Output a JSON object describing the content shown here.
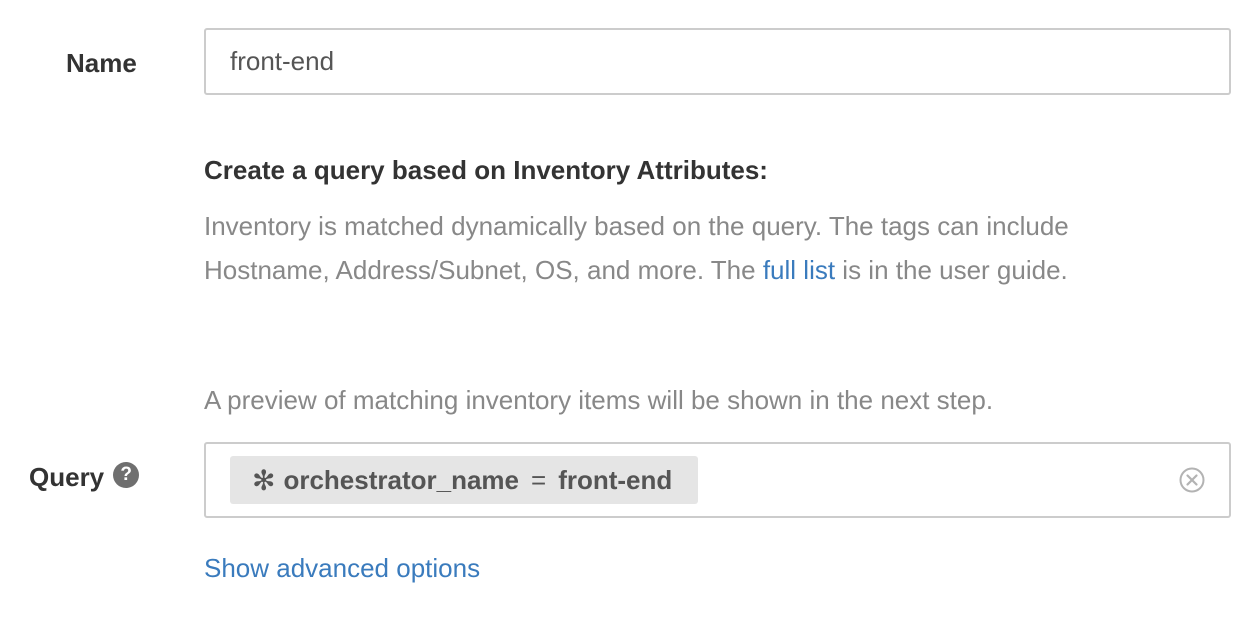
{
  "form": {
    "name_label": "Name",
    "name_value": "front-end",
    "query_label": "Query",
    "help_icon_glyph": "?"
  },
  "query_section": {
    "heading": "Create a query based on Inventory Attributes:",
    "description_part1": "Inventory is matched dynamically based on the query. The tags can include Hostname, Address/Subnet, OS, and more. The ",
    "full_list_link": "full list",
    "description_part2": " is in the user guide.",
    "preview_note": "A preview of matching inventory items will be shown in the next step."
  },
  "query": {
    "token_glyph": "✻",
    "token_attribute": "orchestrator_name",
    "token_operator": "=",
    "token_value": "front-end",
    "clear_icon": "circle-x-icon"
  },
  "advanced_link": "Show advanced options",
  "colors": {
    "link": "#3a7bbd",
    "muted_text": "#888888",
    "token_background": "#e5e5e5",
    "input_border": "#cccccc"
  }
}
